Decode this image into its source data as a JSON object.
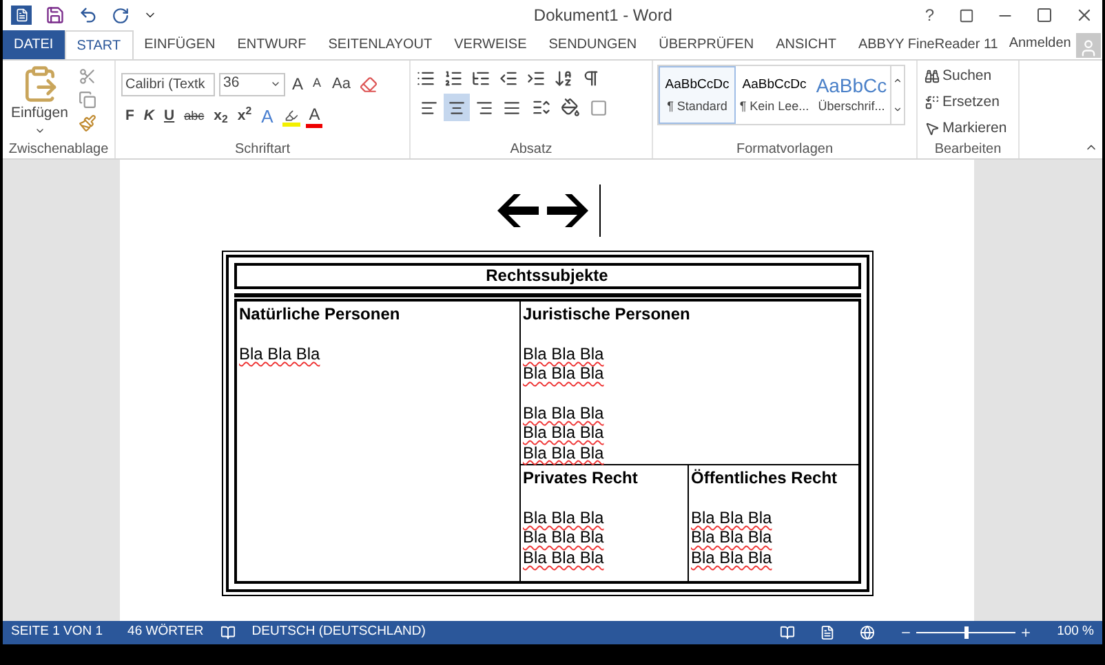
{
  "window": {
    "title": "Dokument1 - Word",
    "help": "?"
  },
  "tabs": [
    {
      "label": "DATEI",
      "kind": "file",
      "selected": false
    },
    {
      "label": "START",
      "kind": "tab",
      "selected": true
    },
    {
      "label": "EINFÜGEN",
      "kind": "tab",
      "selected": false
    },
    {
      "label": "ENTWURF",
      "kind": "tab",
      "selected": false
    },
    {
      "label": "SEITENLAYOUT",
      "kind": "tab",
      "selected": false
    },
    {
      "label": "VERWEISE",
      "kind": "tab",
      "selected": false
    },
    {
      "label": "SENDUNGEN",
      "kind": "tab",
      "selected": false
    },
    {
      "label": "ÜBERPRÜFEN",
      "kind": "tab",
      "selected": false
    },
    {
      "label": "ANSICHT",
      "kind": "tab",
      "selected": false
    },
    {
      "label": "ABBYY FineReader 11",
      "kind": "tab",
      "selected": false
    }
  ],
  "account": "Anmelden",
  "clipboard": {
    "paste": "Einfügen",
    "label": "Zwischenablage"
  },
  "font": {
    "name": "Calibri (Textk",
    "size": "36",
    "grow": "A",
    "shrink": "A",
    "case": "Aa",
    "bold": "F",
    "italic": "K",
    "underline": "U",
    "strike": "abc",
    "subscript": "x$_{2}$",
    "superscript": "x$^{2}$",
    "effects": "A",
    "font_color_letter": "A",
    "label": "Schriftart"
  },
  "paragraph": {
    "alignments": [
      {
        "kind": "left",
        "selected": false
      },
      {
        "kind": "center",
        "selected": true
      },
      {
        "kind": "right",
        "selected": false
      },
      {
        "kind": "justify",
        "selected": false
      }
    ],
    "label": "Absatz"
  },
  "styles": {
    "items": [
      {
        "preview": "AaBbCcDc",
        "name": "¶ Standard",
        "kind": "normal",
        "selected": true
      },
      {
        "preview": "AaBbCcDc",
        "name": "¶ Kein Lee...",
        "kind": "normal",
        "selected": false
      },
      {
        "preview": "AaBbCc",
        "name": "Überschrif...",
        "kind": "heading",
        "selected": false
      }
    ],
    "label": "Formatvorlagen"
  },
  "editing": {
    "find": "Suchen",
    "replace": "Ersetzen",
    "select": "Markieren",
    "label": "Bearbeiten"
  },
  "document": {
    "table": {
      "title": "Rechtssubjekte",
      "natural": {
        "heading": "Natürliche Personen",
        "paragraphs": [
          [
            "Bla Bla Bla"
          ]
        ]
      },
      "legal": {
        "heading": "Juristische Personen",
        "paragraphs": [
          [
            "Bla Bla Bla",
            "Bla Bla Bla"
          ],
          [
            "Bla Bla Bla",
            "Bla Bla Bla",
            "Bla Bla Bla"
          ]
        ]
      },
      "private": {
        "heading": "Privates Recht",
        "paragraphs": [
          [
            "Bla Bla Bla",
            "Bla Bla Bla",
            "Bla Bla Bla"
          ]
        ]
      },
      "public": {
        "heading": "Öffentliches Recht",
        "paragraphs": [
          [
            "Bla Bla Bla",
            "Bla Bla Bla",
            "Bla Bla Bla"
          ]
        ]
      }
    }
  },
  "status_bar": {
    "page": "SEITE 1 VON 1",
    "words": "46 WÖRTER",
    "language": "DEUTSCH (DEUTSCHLAND)",
    "zoom": "100 %",
    "zoom_level": {
      "level": 0.5
    }
  }
}
